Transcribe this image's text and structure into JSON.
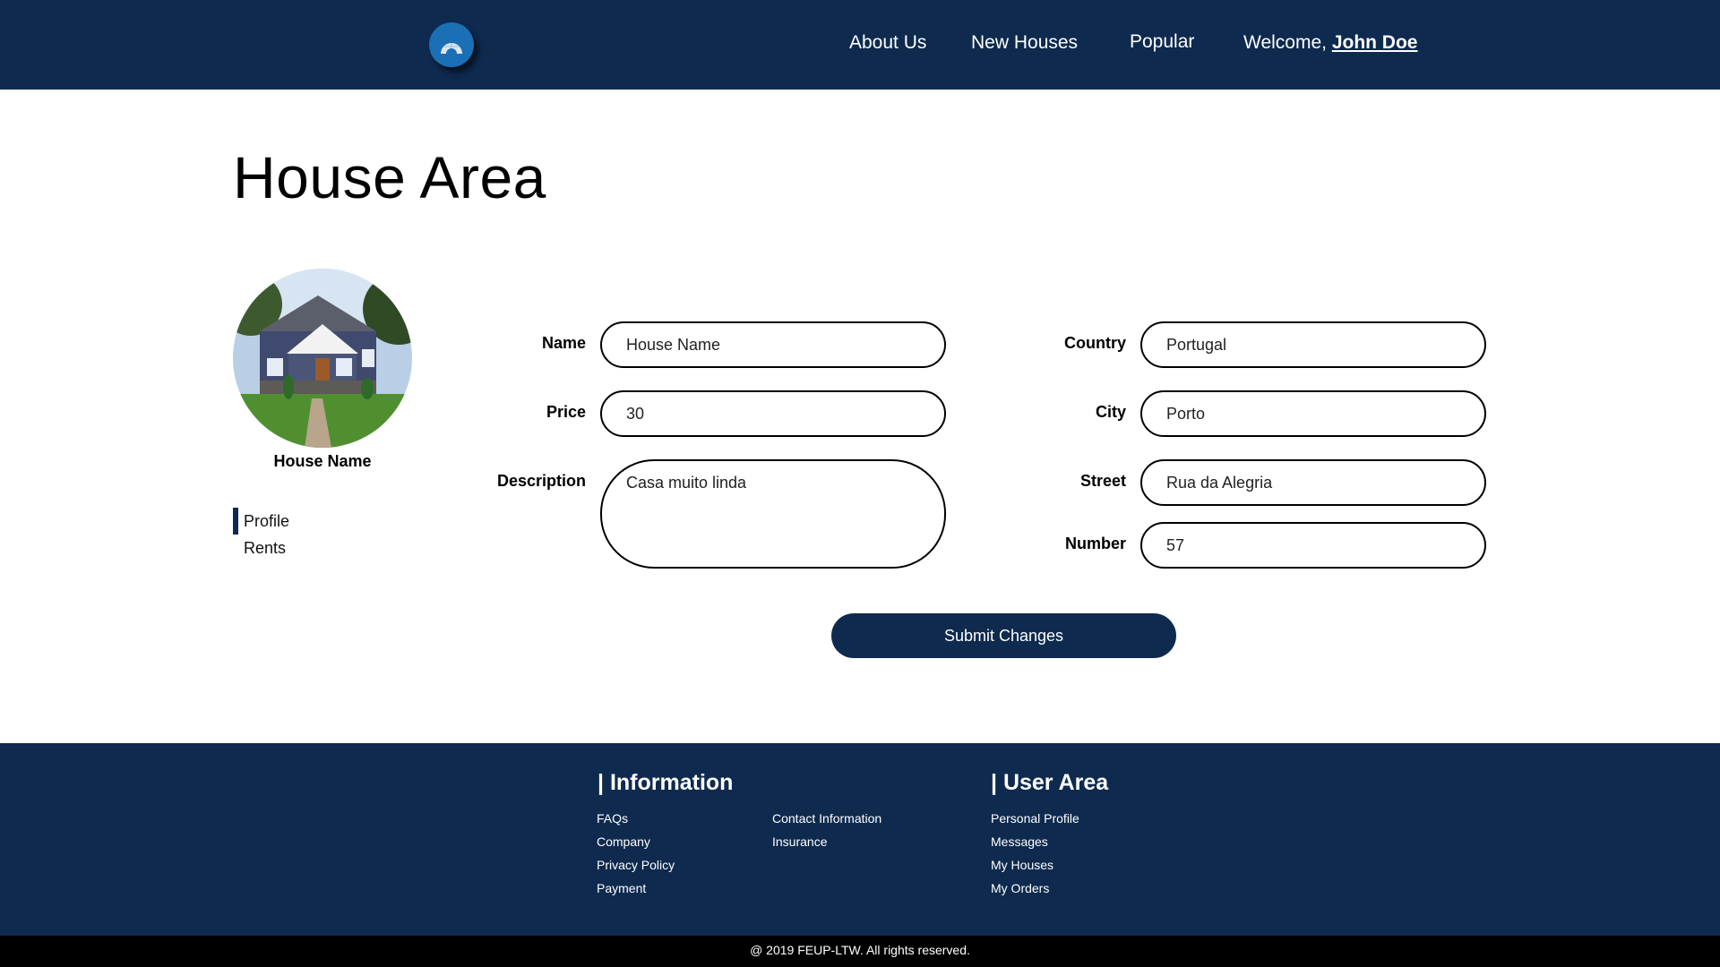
{
  "header": {
    "nav": {
      "about": "About Us",
      "new_houses": "New Houses",
      "popular": "Popular",
      "welcome": "Welcome, ",
      "user": "John Doe"
    }
  },
  "page": {
    "title": "House Area"
  },
  "sidebar": {
    "house_name": "House Name",
    "items": [
      {
        "label": "Profile",
        "active": true
      },
      {
        "label": "Rents",
        "active": false
      }
    ]
  },
  "form": {
    "name": {
      "label": "Name",
      "value": "House Name"
    },
    "price": {
      "label": "Price",
      "value": "30"
    },
    "description": {
      "label": "Description",
      "value": "Casa muito linda"
    },
    "country": {
      "label": "Country",
      "value": "Portugal"
    },
    "city": {
      "label": "City",
      "value": "Porto"
    },
    "street": {
      "label": "Street",
      "value": "Rua da Alegria"
    },
    "number": {
      "label": "Number",
      "value": "57"
    },
    "submit_label": "Submit Changes"
  },
  "footer": {
    "information": {
      "heading": "| Information",
      "links": [
        "FAQs",
        "Company",
        "Privacy Policy",
        "Payment",
        "Contact Information",
        "Insurance"
      ]
    },
    "user_area": {
      "heading": "| User Area",
      "links": [
        "Personal Profile",
        "Messages",
        "My Houses",
        "My Orders"
      ]
    },
    "copyright": "@ 2019 FEUP-LTW. All rights reserved."
  },
  "colors": {
    "navy": "#0e2a4e",
    "logo_blue": "#1b6fb5",
    "black_bar": "#000000"
  }
}
